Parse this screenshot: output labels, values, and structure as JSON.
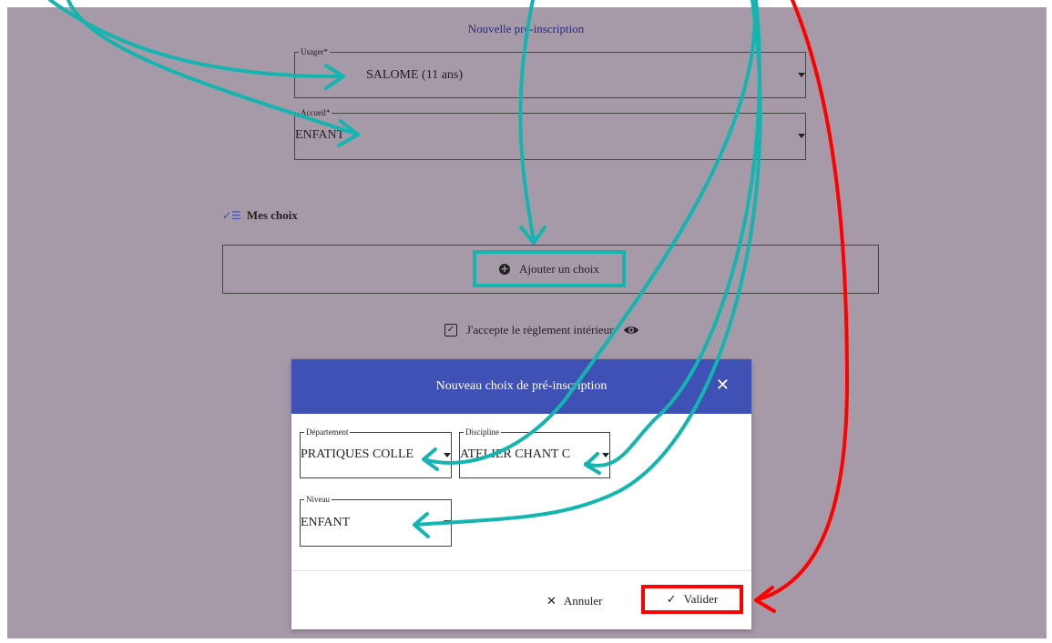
{
  "page": {
    "title": "Nouvelle pré-inscription"
  },
  "form": {
    "usager": {
      "label": "Usager*",
      "value": "SALOME (11 ans)"
    },
    "accueil": {
      "label": "Accueil*",
      "value": "ENFANT"
    }
  },
  "choices": {
    "section_title": "Mes choix",
    "add_button": "Ajouter un choix",
    "accept_text": "J'accepte le règlement intérieur"
  },
  "dialog": {
    "title": "Nouveau choix de pré-inscription",
    "departement": {
      "label": "Département",
      "value": "PRATIQUES COLLE"
    },
    "discipline": {
      "label": "Discipline",
      "value": "ATELIER CHANT C"
    },
    "niveau": {
      "label": "Niveau",
      "value": "ENFANT"
    },
    "cancel_label": "Annuler",
    "validate_label": "Valider"
  },
  "icons": {
    "checklist": "checklist-icon",
    "plus": "plus-circle-icon",
    "checkbox": "checkbox-checked-icon",
    "eye": "eye-icon",
    "close": "close-icon",
    "check": "check-icon"
  },
  "colors": {
    "backdrop": "#a79aa8",
    "dialog_header": "#3f51b5",
    "annotation_teal": "#12b5b0",
    "annotation_red": "#ff0000"
  }
}
